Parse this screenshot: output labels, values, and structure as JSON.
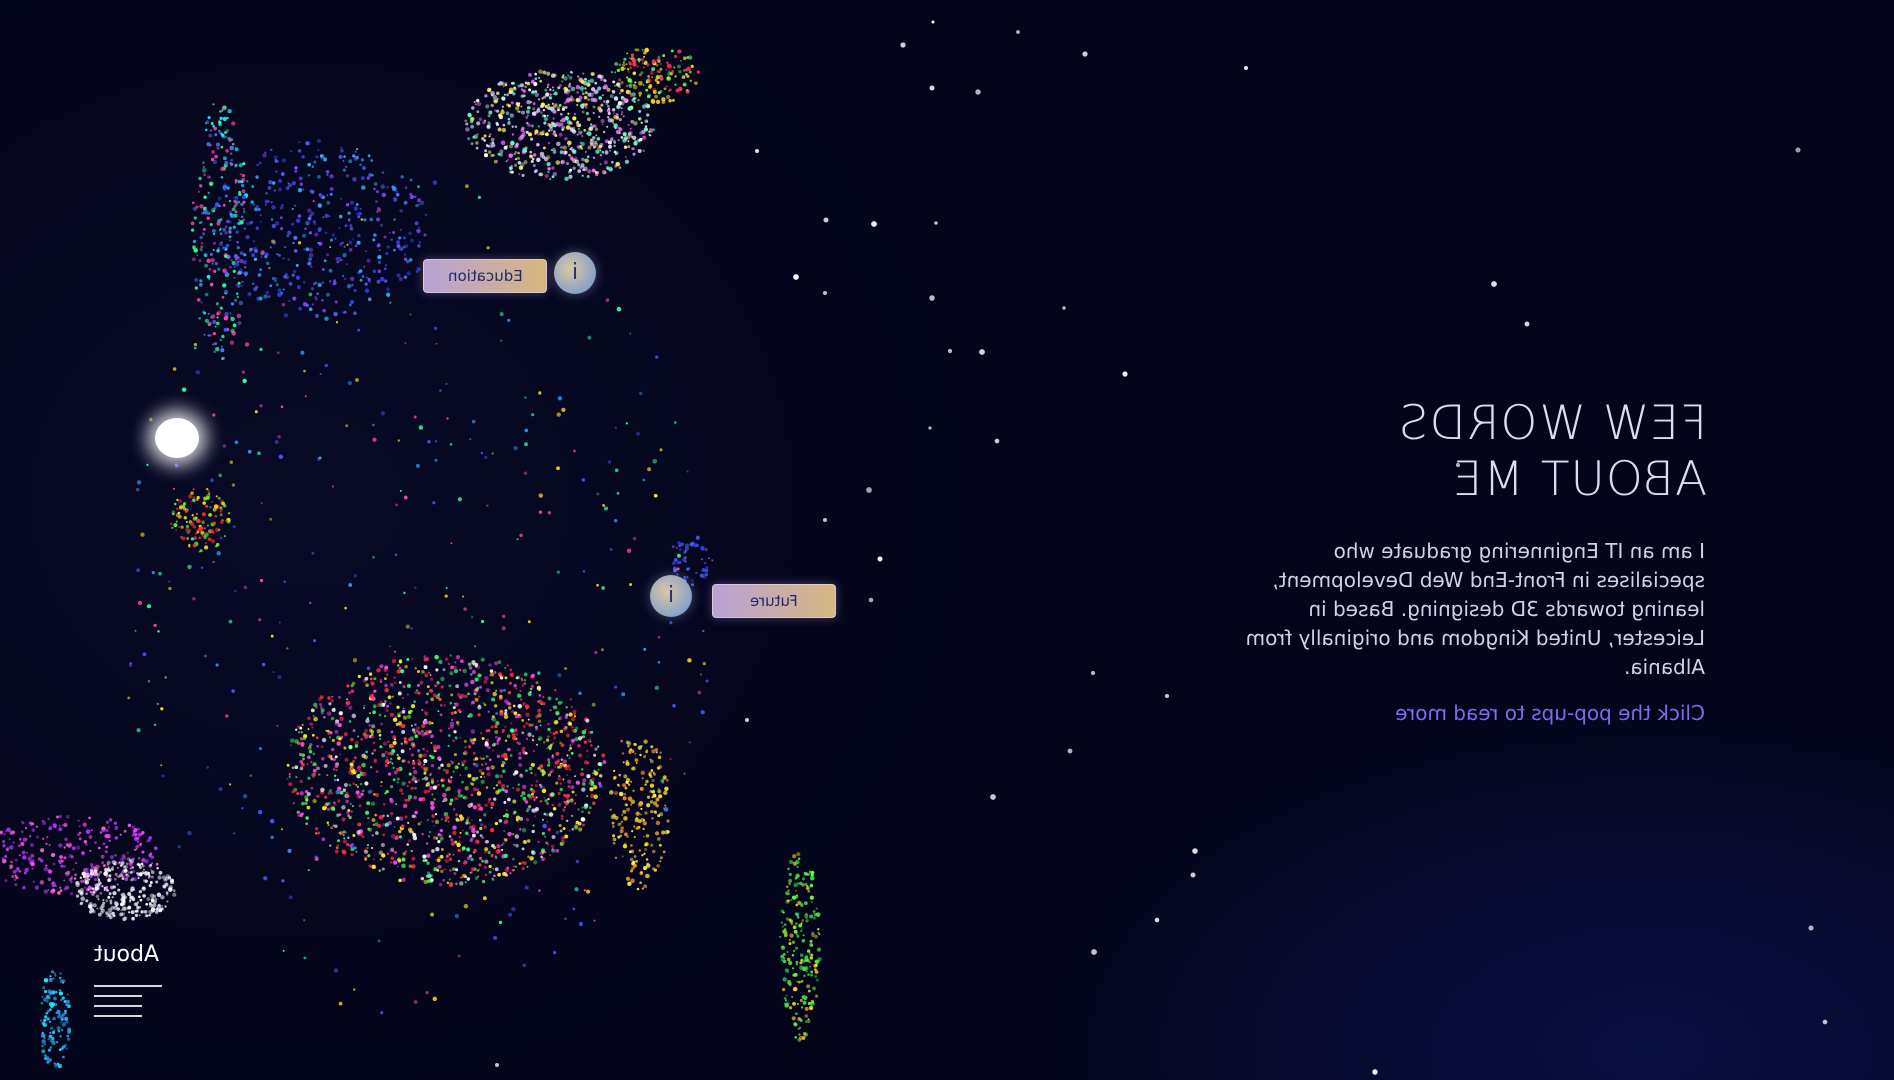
{
  "about": {
    "heading": "FEW WORDS ABOUT ME",
    "description": "I am an IT Enginnering graduate who specialises in Front-End Web Development, leaning towards 3D designing. Based in Leicester, United Kingdom and originally from Albania.",
    "hint": "Click the pop-ups to read more"
  },
  "popups": {
    "education_label": "Education",
    "future_label": "Future",
    "info_glyph": "i"
  },
  "nav": {
    "label": "About"
  },
  "icons": {
    "info": "info-icon",
    "menu": "menu-lines-icon"
  },
  "colors": {
    "background": "#04051a",
    "accent": "#7d6cf0",
    "popup_text": "#1e2a6d"
  }
}
